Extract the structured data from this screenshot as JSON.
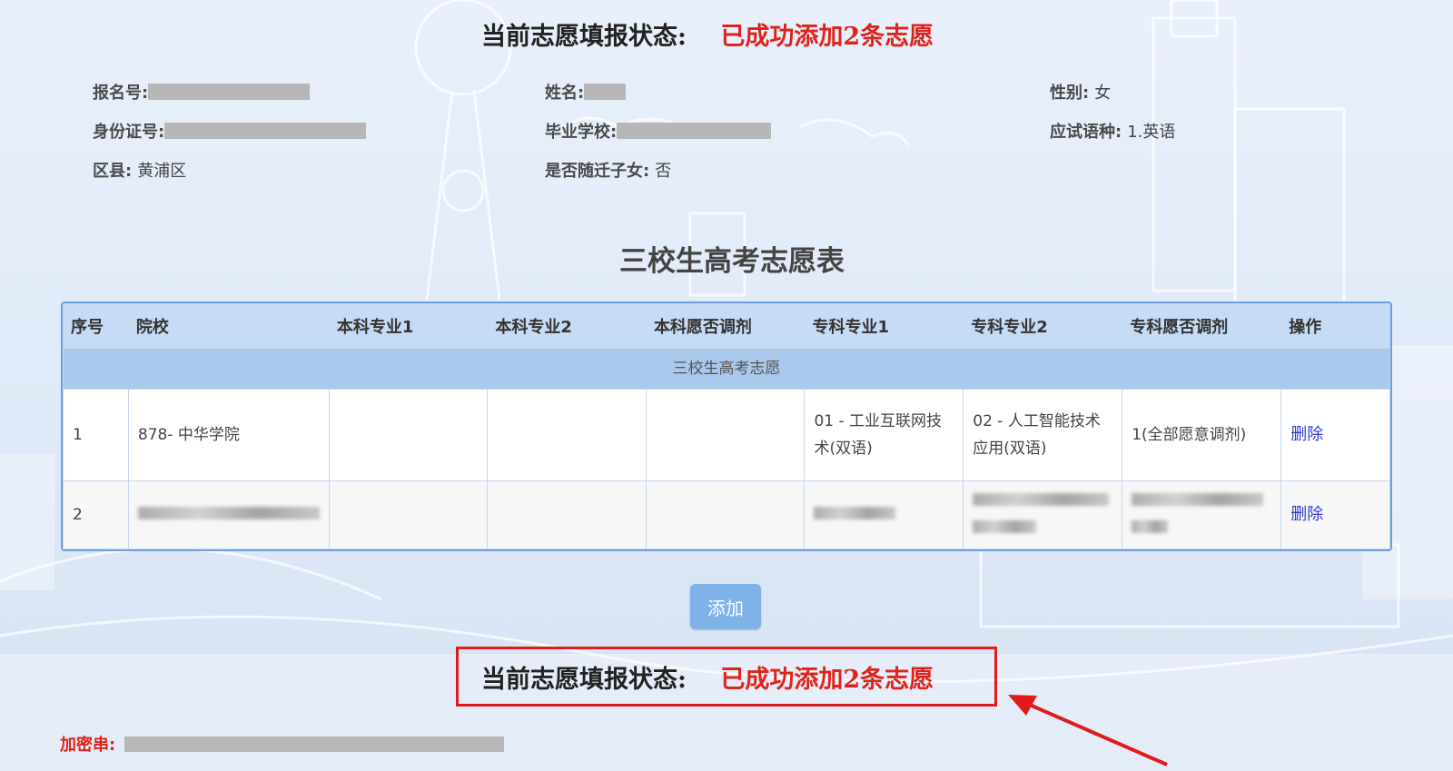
{
  "status_top": {
    "label": "当前志愿填报状态:",
    "value": "已成功添加2条志愿"
  },
  "info": {
    "reg_no": {
      "label": "报名号:"
    },
    "name": {
      "label": "姓名:"
    },
    "gender": {
      "label": "性别:",
      "value": "女"
    },
    "id_no": {
      "label": "身份证号:"
    },
    "school": {
      "label": "毕业学校:"
    },
    "lang": {
      "label": "应试语种:",
      "value": "1.英语"
    },
    "district": {
      "label": "区县:",
      "value": "黄浦区"
    },
    "migrant": {
      "label": "是否随迁子女:",
      "value": "否"
    }
  },
  "table_title": "三校生高考志愿表",
  "table": {
    "headers": [
      "序号",
      "院校",
      "本科专业1",
      "本科专业2",
      "本科愿否调剂",
      "专科专业1",
      "专科专业2",
      "专科愿否调剂",
      "操作"
    ],
    "group_label": "三校生高考志愿",
    "rows": [
      {
        "no": "1",
        "school": "878- 中华学院",
        "bk1": "",
        "bk2": "",
        "bk_adjust": "",
        "zk1": "01 - 工业互联网技术(双语)",
        "zk2": "02 - 人工智能技术应用(双语)",
        "zk_adjust": "1(全部愿意调剂)",
        "action": "删除"
      },
      {
        "no": "2",
        "school": "",
        "bk1": "",
        "bk2": "",
        "bk_adjust": "",
        "zk1": "",
        "zk2": "",
        "zk_adjust": "",
        "action": "删除"
      }
    ]
  },
  "add_button": "添加",
  "status_bottom": {
    "label": "当前志愿填报状态:",
    "value": "已成功添加2条志愿"
  },
  "cipher": {
    "label": "加密串:"
  },
  "colors": {
    "accent_red": "#e0241b",
    "header_blue": "#c6dbf5",
    "group_blue": "#a9c8ec",
    "link_blue": "#2b3bd6",
    "button_blue": "#7fb2e8"
  }
}
